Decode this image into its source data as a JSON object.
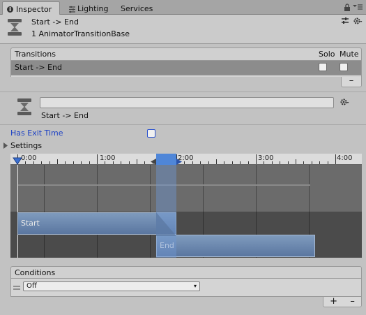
{
  "tabs": [
    {
      "label": "Inspector",
      "icon": "info-icon",
      "active": true
    },
    {
      "label": "Lighting",
      "icon": "lighting-icon",
      "active": false
    },
    {
      "label": "Services",
      "icon": "",
      "active": false
    }
  ],
  "header": {
    "title": "Start -> End",
    "subtitle": "1 AnimatorTransitionBase"
  },
  "transitions": {
    "header_label": "Transitions",
    "solo_label": "Solo",
    "mute_label": "Mute",
    "rows": [
      {
        "label": "Start -> End",
        "solo": false,
        "mute": false
      }
    ],
    "remove_label": "–"
  },
  "transition_detail": {
    "name_value": "",
    "label": "Start -> End"
  },
  "has_exit_time": {
    "label": "Has Exit Time",
    "checked": false
  },
  "settings": {
    "label": "Settings",
    "expanded": false
  },
  "timeline": {
    "ticks": [
      "0:00",
      "1:00",
      "2:00",
      "3:00",
      "4:00"
    ],
    "states": [
      {
        "label": "Start"
      },
      {
        "label": "End"
      }
    ]
  },
  "conditions": {
    "header_label": "Conditions",
    "rows": [
      {
        "value": "Off"
      }
    ],
    "add_label": "+",
    "remove_label": "–"
  },
  "colors": {
    "accent_blue": "#5a76a0",
    "link_blue": "#1a3fc4"
  }
}
